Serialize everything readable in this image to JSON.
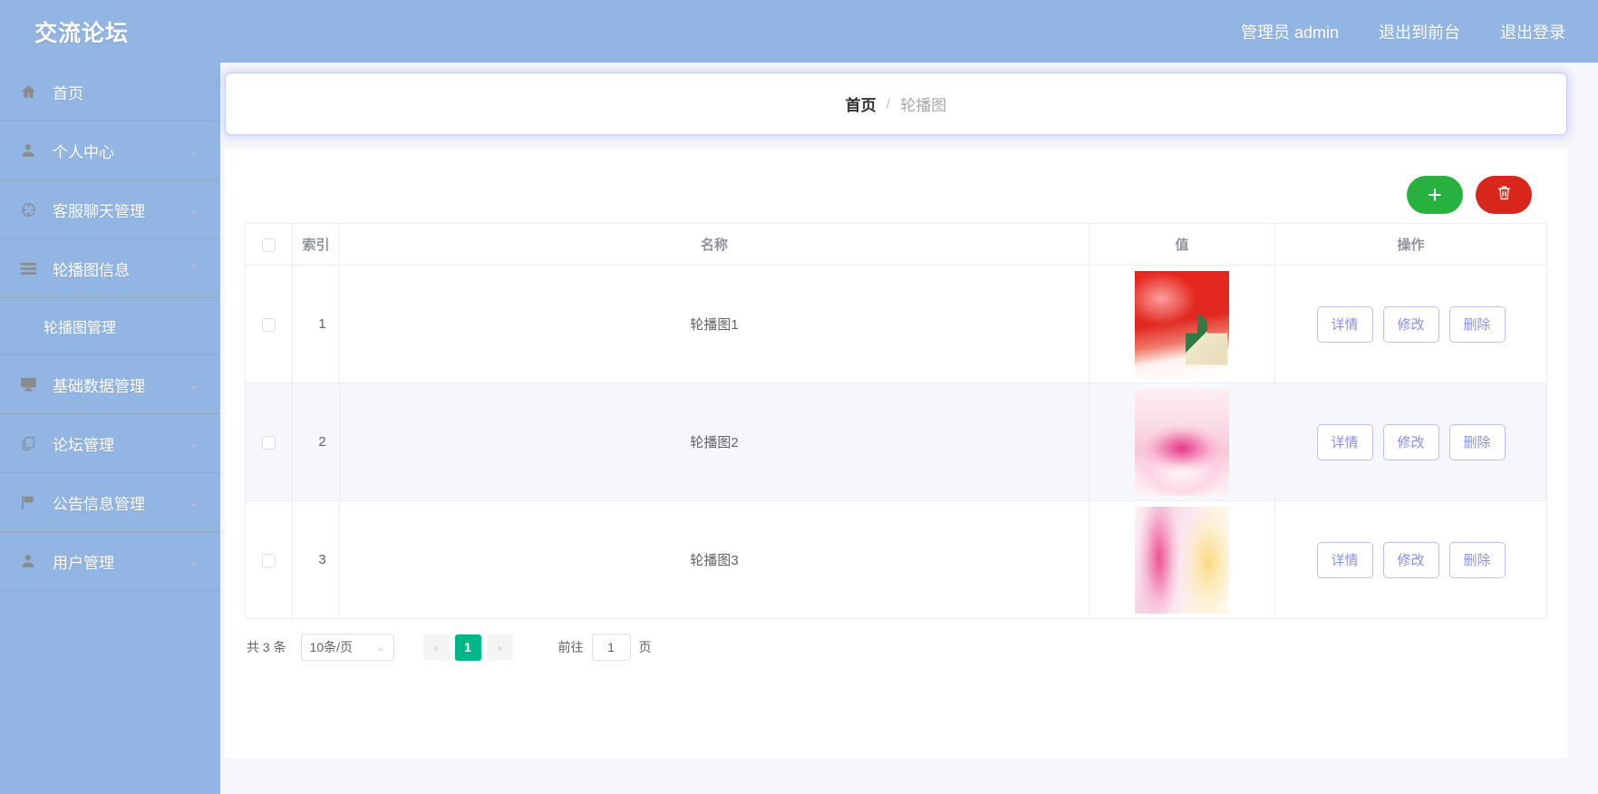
{
  "header": {
    "brand": "交流论坛",
    "links": [
      {
        "label": "管理员 admin",
        "name": "admin-user-link"
      },
      {
        "label": "退出到前台",
        "name": "exit-to-frontend-link"
      },
      {
        "label": "退出登录",
        "name": "logout-link"
      }
    ]
  },
  "sidebar": {
    "items": [
      {
        "label": "首页",
        "icon": "home-icon",
        "arrow": "",
        "expanded": false
      },
      {
        "label": "个人中心",
        "icon": "user-icon",
        "arrow": "⌄",
        "expanded": false
      },
      {
        "label": "客服聊天管理",
        "icon": "chat-target-icon",
        "arrow": "⌄",
        "expanded": false
      },
      {
        "label": "轮播图信息",
        "icon": "list-icon",
        "arrow": "⌃",
        "expanded": true
      },
      {
        "label": "基础数据管理",
        "icon": "monitor-icon",
        "arrow": "⌄",
        "expanded": false
      },
      {
        "label": "论坛管理",
        "icon": "copy-icon",
        "arrow": "⌄",
        "expanded": false
      },
      {
        "label": "公告信息管理",
        "icon": "flag-icon",
        "arrow": "⌄",
        "expanded": false
      },
      {
        "label": "用户管理",
        "icon": "user-icon",
        "arrow": "⌄",
        "expanded": false
      }
    ],
    "submenu": {
      "parent_index": 3,
      "label": "轮播图管理"
    }
  },
  "breadcrumb": {
    "home": "首页",
    "separator": "/",
    "current": "轮播图"
  },
  "toolbar": {
    "add_label": "+",
    "add_icon": "plus-icon",
    "delete_icon": "trash-icon",
    "add_color": "#29b13f",
    "delete_color": "#d9261c"
  },
  "table": {
    "columns": [
      "索引",
      "名称",
      "值",
      "操作"
    ],
    "rows": [
      {
        "index": "1",
        "name": "轮播图1",
        "image_desc": "red-winter-scene-thumbnail",
        "actions": [
          "详情",
          "修改",
          "删除"
        ]
      },
      {
        "index": "2",
        "name": "轮播图2",
        "image_desc": "pink-cake-flowers-thumbnail",
        "actions": [
          "详情",
          "修改",
          "删除"
        ]
      },
      {
        "index": "3",
        "name": "轮播图3",
        "image_desc": "pink-yellow-blur-thumbnail",
        "actions": [
          "详情",
          "修改",
          "删除"
        ]
      }
    ]
  },
  "pagination": {
    "total_label": "共 3 条",
    "page_size": "10条/页",
    "prev": "‹",
    "next": "›",
    "current_page": "1",
    "jump_label": "前往",
    "jump_value": "1",
    "jump_unit": "页"
  },
  "colors": {
    "header_bg": "#92b5e4",
    "accent_green": "#00b887",
    "action_btn": "#8a92e8",
    "stripe": "#f5f7fa"
  }
}
